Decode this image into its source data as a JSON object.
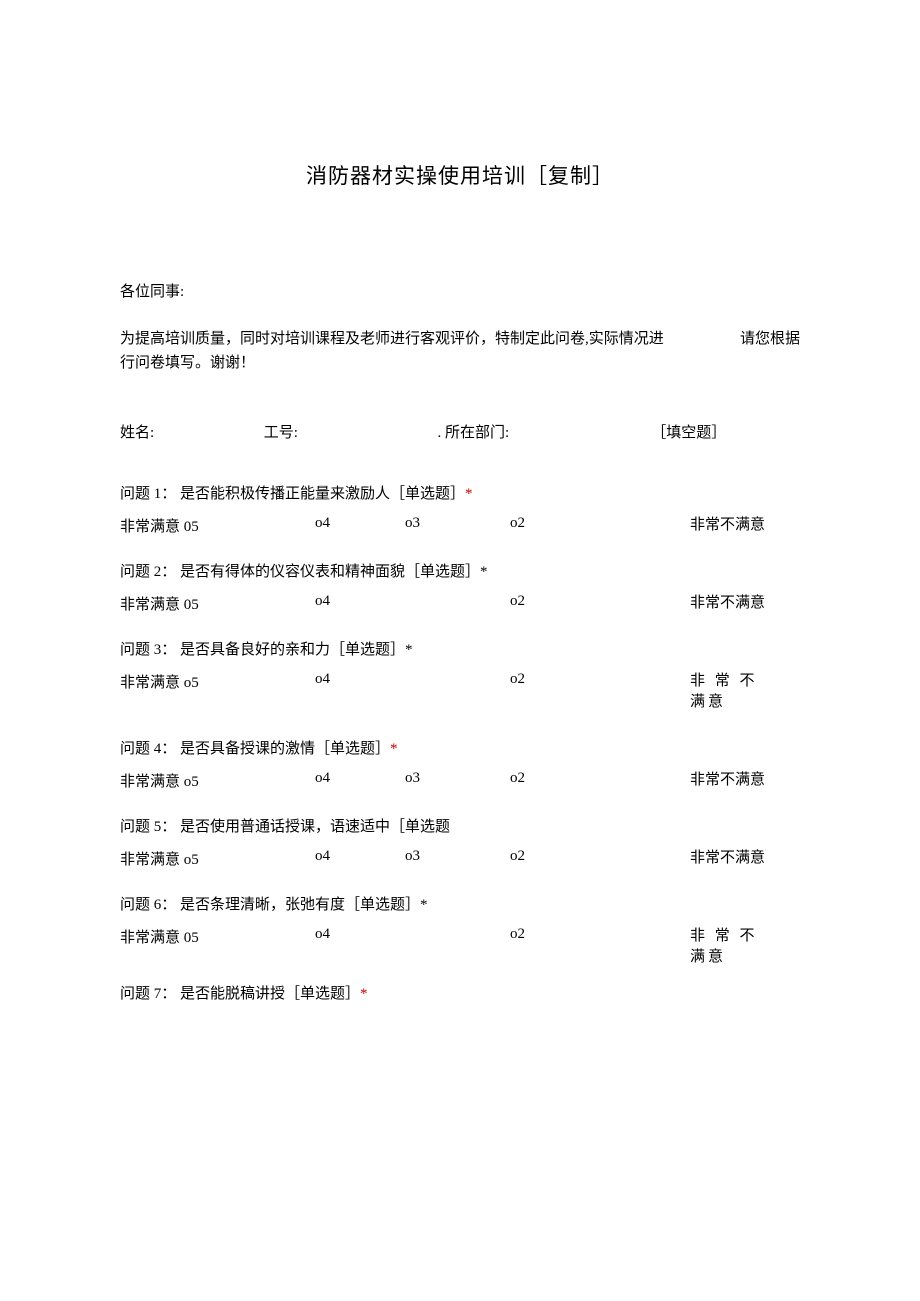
{
  "title": "消防器材实操使用培训［复制］",
  "greeting": "各位同事:",
  "intro_left": "为提高培训质量，同时对培训课程及老师进行客观评价，特制定此问卷,实际情况进",
  "intro_right": "请您根据",
  "intro_line2": "行问卷填写。谢谢！",
  "fill": {
    "name": "姓名:",
    "emp": "工号:",
    "dept": ". 所在部门:",
    "tag": "［填空题］"
  },
  "opt_left_prefix": "非常满意",
  "opt_right": "非常不满意",
  "opt_right_sp": "非 常 不 满意",
  "o5a": " 05",
  "o5b": " o5",
  "o4": "o4",
  "o3": "o3",
  "o2": "o2",
  "q": [
    {
      "title": "问题 1： 是否能积极传播正能量来激励人［单选题］",
      "has3": true,
      "o5": "a",
      "right": "n",
      "star": true
    },
    {
      "title": "问题 2： 是否有得体的仪容仪表和精神面貌［单选题］*",
      "has3": false,
      "o5": "a",
      "right": "n",
      "star": false
    },
    {
      "title": "问题 3： 是否具备良好的亲和力［单选题］*",
      "has3": false,
      "o5": "b",
      "right": "sp",
      "star": false
    },
    {
      "title": "问题 4： 是否具备授课的激情［单选题］",
      "has3": true,
      "o5": "b",
      "right": "n",
      "star": true
    },
    {
      "title": "问题 5： 是否使用普通话授课，语速适中［单选题",
      "has3": true,
      "o5": "b",
      "right": "n",
      "star": false
    },
    {
      "title": "问题 6： 是否条理清晰，张弛有度［单选题］*",
      "has3": false,
      "o5": "a",
      "right": "sp",
      "star": false
    }
  ],
  "q7": "问题 7： 是否能脱稿讲授［单选题］",
  "star": "*"
}
